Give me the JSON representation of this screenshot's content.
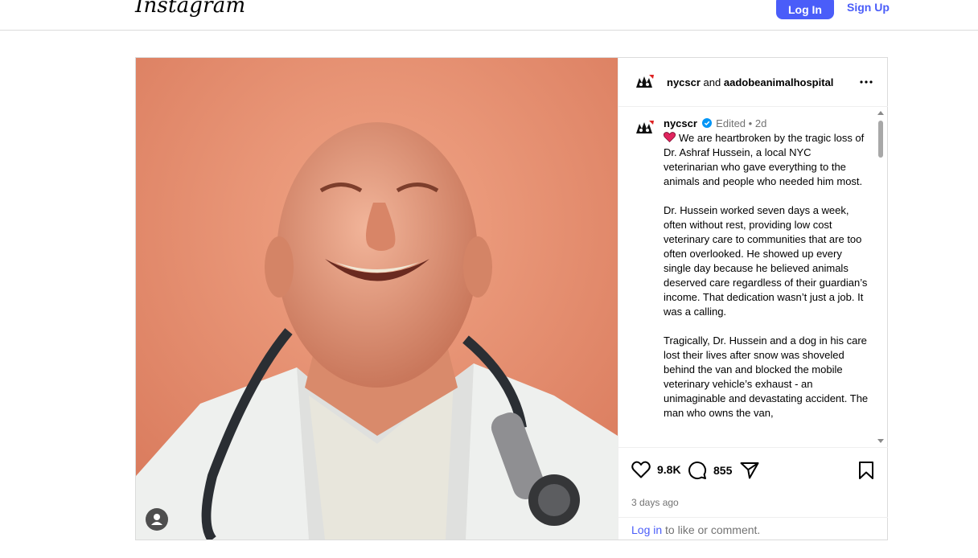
{
  "header": {
    "logo_text": "Instagram",
    "login_label": "Log In",
    "signup_label": "Sign Up"
  },
  "post": {
    "author": "nycscr",
    "and_text": "and",
    "collaborator": "aadobeanimalhospital",
    "caption_user": "nycscr",
    "edited_text": "Edited",
    "separator": "•",
    "age": "2d",
    "caption_text": "We are heartbroken by the tragic loss of Dr. Ashraf Hussein, a local NYC veterinarian who gave everything to the animals and people who needed him most.\n\nDr. Hussein worked seven days a week, often without rest, providing low cost veterinary care to communities that are too often overlooked. He showed up every single day because he believed animals deserved care regardless of their guardian’s income. That dedication wasn’t just a job. It was a calling.\n\nTragically, Dr. Hussein and a dog in his care lost their lives after snow was shoveled behind the van and blocked the mobile veterinary vehicle’s exhaust - an unimaginable and devastating accident. The man who owns the van,",
    "likes": "9.8K",
    "comments": "855",
    "timestamp": "3 days ago",
    "login_link": "Log in",
    "login_suffix": " to like or comment."
  },
  "colors": {
    "accent": "#4a5df9",
    "verified": "#0095f6",
    "muted": "#737373"
  },
  "icons": [
    "more-icon",
    "verified-icon",
    "heart-emoji-icon",
    "like-icon",
    "comment-icon",
    "share-icon",
    "save-icon",
    "user-tag-icon"
  ]
}
